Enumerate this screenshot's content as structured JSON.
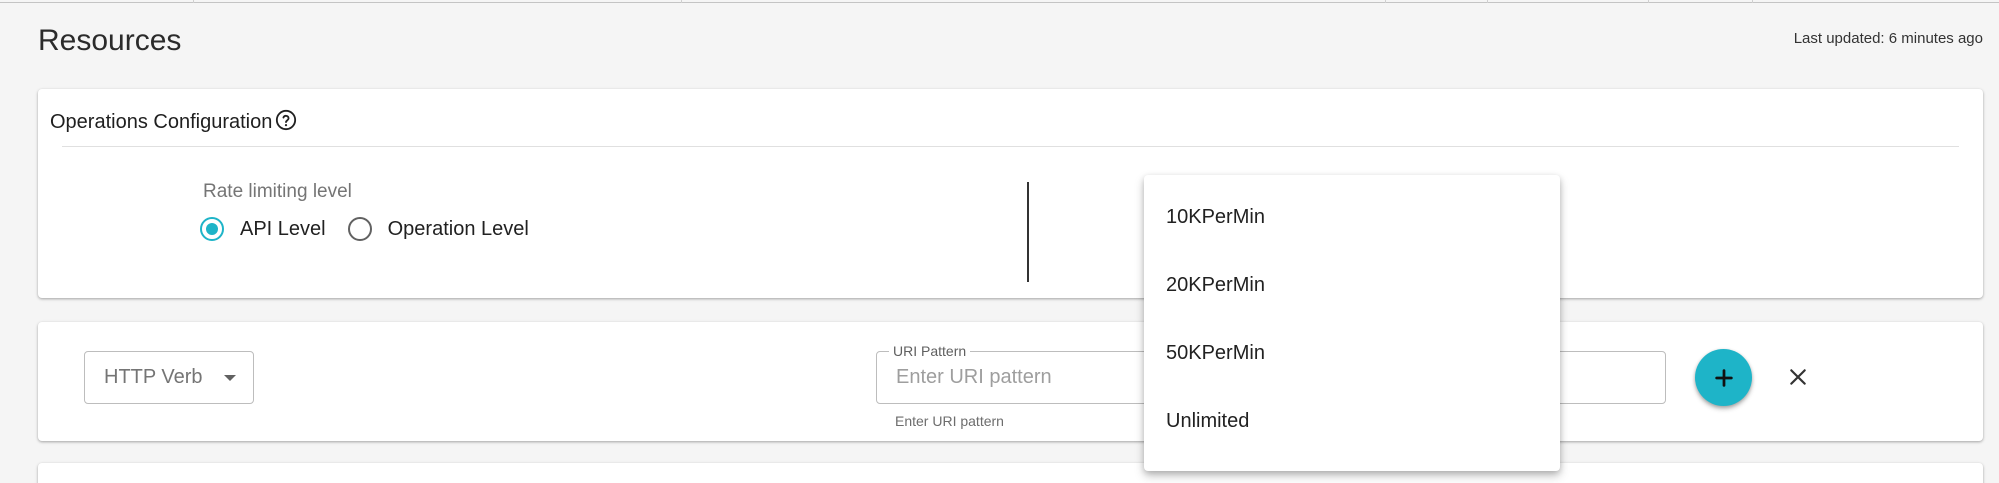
{
  "header": {
    "title": "Resources",
    "last_updated": "Last updated: 6 minutes ago"
  },
  "operations_config": {
    "title": "Operations Configuration",
    "help_icon": "help-circle-icon",
    "rate_limiting": {
      "label": "Rate limiting level",
      "options": [
        {
          "label": "API Level",
          "selected": true
        },
        {
          "label": "Operation Level",
          "selected": false
        }
      ]
    }
  },
  "resource_form": {
    "http_verb_placeholder": "HTTP Verb",
    "uri_pattern": {
      "label": "URI Pattern",
      "placeholder": "Enter URI pattern",
      "helper": "Enter URI pattern",
      "value": ""
    },
    "add_icon": "plus-icon",
    "close_icon": "close-icon"
  },
  "rate_limit_menu": {
    "items": [
      "10KPerMin",
      "20KPerMin",
      "50KPerMin",
      "Unlimited"
    ]
  },
  "colors": {
    "accent": "#1eb4c8",
    "background": "#f5f5f5",
    "card": "#ffffff"
  }
}
